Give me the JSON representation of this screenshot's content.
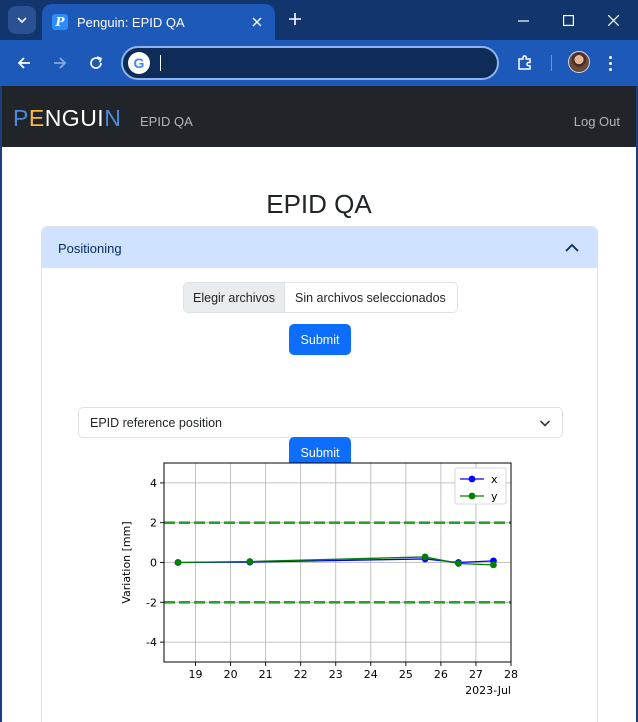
{
  "browser": {
    "tab_title": "Penguin: EPID QA",
    "address_value": "",
    "colors": {
      "frame": "#12356e",
      "toolbar": "#1d59b8",
      "omnibox": "#0f2b57"
    }
  },
  "app": {
    "brand": {
      "letters": [
        "P",
        "E",
        "NGUI",
        "N"
      ]
    },
    "nav_link": "EPID QA",
    "logout": "Log Out",
    "page_title": "EPID QA",
    "accordion": {
      "title": "Positioning",
      "file_button": "Elegir archivos",
      "file_status": "Sin archivos seleccionados",
      "submit_upload": "Submit",
      "select_value": "EPID reference position",
      "submit_select": "Submit"
    },
    "colors": {
      "navbar": "#212529",
      "primary": "#0d6efd",
      "accordion_header": "#cfe2ff"
    }
  },
  "icons": [
    "chevron-down-icon",
    "plus-icon",
    "close-icon",
    "minimize-icon",
    "maximize-icon",
    "back-arrow-icon",
    "forward-arrow-icon",
    "reload-icon",
    "google-icon",
    "extensions-icon",
    "profile-avatar",
    "kebab-menu-icon",
    "chevron-up-icon"
  ],
  "chart_data": {
    "type": "line",
    "title": "",
    "xlabel": "",
    "x_offset_label": "2023-Jul",
    "ylabel": "Variation [mm]",
    "xlim": [
      18.1,
      28.0
    ],
    "ylim": [
      -5,
      5
    ],
    "x_ticks": [
      19,
      20,
      21,
      22,
      23,
      24,
      25,
      26,
      27,
      28
    ],
    "y_ticks": [
      -4,
      -2,
      0,
      2,
      4
    ],
    "grid": true,
    "legend_position": "top-right",
    "series": [
      {
        "name": "x",
        "color": "#0000ff",
        "x": [
          18.5,
          20.55,
          25.55,
          26.5,
          27.5
        ],
        "y": [
          0.0,
          0.02,
          0.18,
          0.0,
          0.08
        ]
      },
      {
        "name": "y",
        "color": "#008000",
        "x": [
          18.5,
          20.55,
          25.55,
          26.5,
          27.5
        ],
        "y": [
          0.0,
          0.05,
          0.28,
          -0.05,
          -0.12
        ]
      }
    ],
    "reference_lines": [
      {
        "y": 2,
        "color": "#2ca02c",
        "style": "dashed"
      },
      {
        "y": -2,
        "color": "#2ca02c",
        "style": "dashed"
      }
    ]
  }
}
